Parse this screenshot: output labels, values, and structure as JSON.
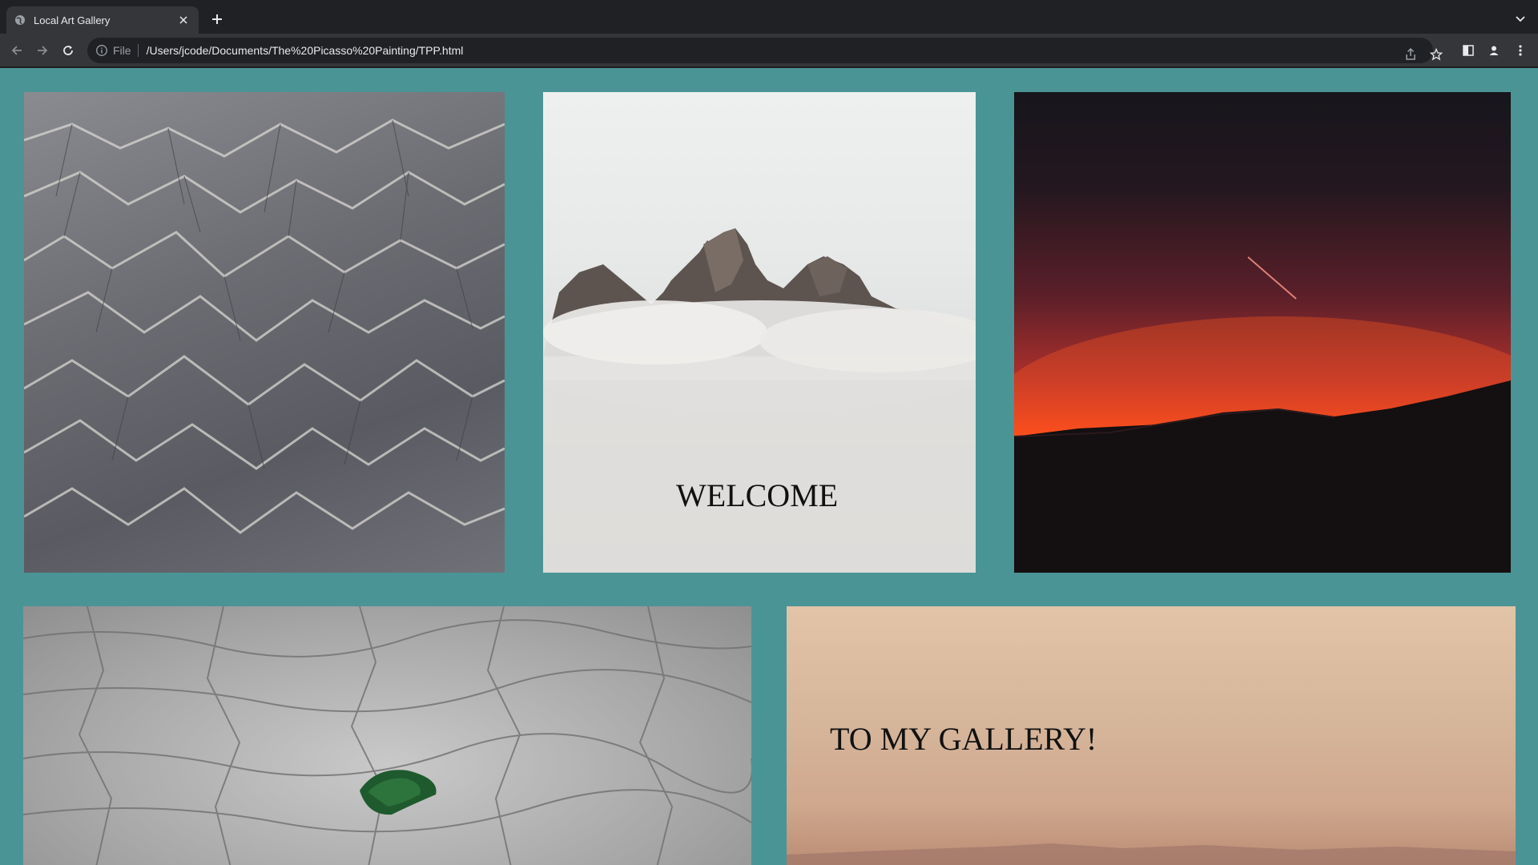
{
  "browser": {
    "tab": {
      "title": "Local Art Gallery"
    },
    "address": {
      "scheme_label": "File",
      "url": "/Users/jcode/Documents/The%20Picasso%20Painting/TPP.html"
    }
  },
  "gallery": {
    "background_color": "#4b9496",
    "welcome_text": "WELCOME",
    "subtitle_text": "TO MY GALLERY!"
  }
}
